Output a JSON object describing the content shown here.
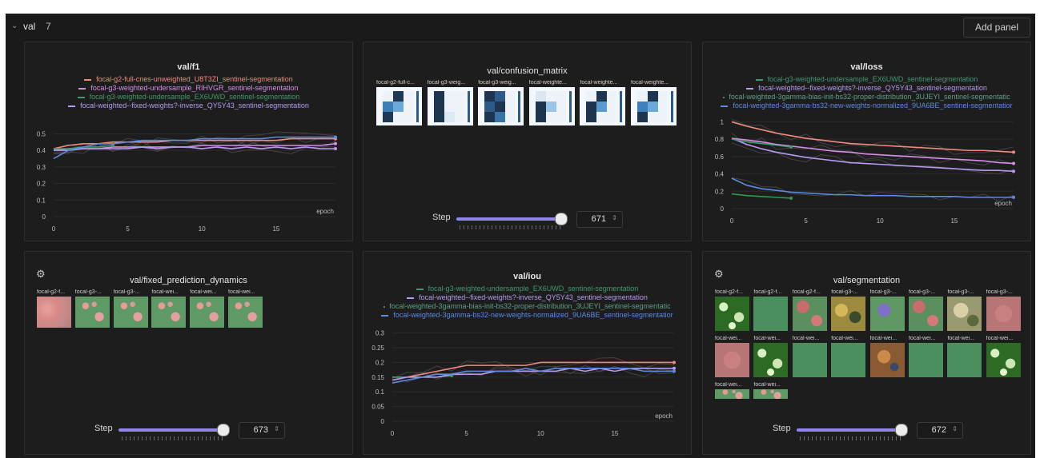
{
  "section": {
    "chevron": "chevron-down-icon",
    "title": "val",
    "count": "7",
    "add_panel": "Add panel"
  },
  "colors": {
    "red": "#f08a7e",
    "pink": "#d88ee8",
    "green": "#3f9a6f",
    "lilac": "#b79af0",
    "blue": "#5b8ae0",
    "accent": "#8f86f0",
    "faint": "#4c4c4c"
  },
  "panels": {
    "f1": {
      "title": "val/f1",
      "legend": [
        {
          "label": "focal-g2-full-cnes-unweighted_U8T3ZI_sentinel-segmentation",
          "color": "#f08a7e"
        },
        {
          "label": "focal-g3-weighted-undersample_RIHVGR_sentinel-segmentation",
          "color": "#d88ee8"
        },
        {
          "label": "focal-g3-weighted-undersample_EX6UWD_sentinel-segmentation",
          "color": "#3f9a6f"
        },
        {
          "label": "focal-weighted--fixed-weights?-inverse_QY5Y43_sentinel-segmentation",
          "color": "#b79af0"
        }
      ],
      "x_label": "epoch",
      "x_ticks": [
        "0",
        "5",
        "10",
        "15"
      ],
      "y_ticks": [
        "0",
        "0.1",
        "0.2",
        "0.3",
        "0.4",
        "0.5"
      ]
    },
    "confusion": {
      "title": "val/confusion_matrix",
      "labels": [
        "focal-g2-full-c...",
        "focal-g3-weig...",
        "focal-g3-weig...",
        "focal-weighte...",
        "focal-weighte...",
        "focal-weighte..."
      ],
      "step_label": "Step",
      "step_value": "671"
    },
    "loss": {
      "title": "val/loss",
      "legend": [
        {
          "label": "focal-g3-weighted-undersample_EX6UWD_sentinel-segmentation",
          "color": "#3f9a6f"
        },
        {
          "label": "focal-weighted--fixed-weights?-inverse_QY5Y43_sentinel-segmentation",
          "color": "#b79af0"
        },
        {
          "label": "focal-weighted-3gamma-bias-init-bs32-proper-distribution_3UJEYI_sentinel-segmentatic",
          "color": "#5fa083",
          "dot": true
        },
        {
          "label": "focal-weighted-3gamma-bs32-new-weights-normalized_9UA6BE_sentinel-segmentatior",
          "color": "#5b8ae0"
        }
      ],
      "x_label": "epoch",
      "x_ticks": [
        "0",
        "5",
        "10",
        "15"
      ],
      "y_ticks": [
        "0",
        "0.2",
        "0.4",
        "0.6",
        "0.8",
        "1"
      ]
    },
    "dynamics": {
      "gear": "gear-icon",
      "title": "val/fixed_prediction_dynamics",
      "labels": [
        "focal-g2-f...",
        "focal-g3-...",
        "focal-g3-...",
        "focal-wei...",
        "focal-wei...",
        "focal-wei..."
      ],
      "step_label": "Step",
      "step_value": "673"
    },
    "iou": {
      "title": "val/iou",
      "legend": [
        {
          "label": "focal-g3-weighted-undersample_EX6UWD_sentinel-segmentation",
          "color": "#3f9a6f"
        },
        {
          "label": "focal-weighted--fixed-weights?-inverse_QY5Y43_sentinel-segmentation",
          "color": "#b79af0"
        },
        {
          "label": "focal-weighted-3gamma-bias-init-bs32-proper-distribution_3UJEYI_sentinel-segmentatic",
          "color": "#5fa083",
          "dot": true
        },
        {
          "label": "focal-weighted-3gamma-bs32-new-weights-normalized_9UA6BE_sentinel-segmentatior",
          "color": "#5b8ae0"
        }
      ],
      "x_label": "epoch",
      "x_ticks": [
        "0",
        "5",
        "10",
        "15"
      ],
      "y_ticks": [
        "0",
        "0.05",
        "0.1",
        "0.15",
        "0.2",
        "0.25",
        "0.3"
      ]
    },
    "segmentation": {
      "gear": "gear-icon",
      "title": "val/segmentation",
      "labels": [
        "focal-g2-f...",
        "focal-g2-f...",
        "focal-g2-f...",
        "focal-g3-...",
        "focal-g3-...",
        "focal-g3-...",
        "focal-g3-...",
        "focal-g3-...",
        "focal-wei...",
        "focal-wei...",
        "focal-wei...",
        "focal-wei...",
        "focal-wei...",
        "focal-wei...",
        "focal-wei...",
        "focal-wei..."
      ],
      "step_label": "Step",
      "step_value": "672"
    }
  },
  "chart_data": [
    {
      "type": "line",
      "title": "val/f1",
      "xlabel": "epoch",
      "xlim": [
        0,
        19
      ],
      "ylim": [
        0,
        0.55
      ],
      "series": [
        {
          "name": "focal-g2-full-cnes-unweighted_U8T3ZI_sentinel-segmentation",
          "color": "#f08a7e",
          "x": [
            0,
            1,
            2,
            3,
            4,
            5,
            6,
            7,
            8,
            9,
            10,
            11,
            12,
            13,
            14,
            15,
            16,
            17,
            18,
            19
          ],
          "y": [
            0.41,
            0.43,
            0.44,
            0.44,
            0.45,
            0.45,
            0.45,
            0.45,
            0.46,
            0.46,
            0.46,
            0.46,
            0.46,
            0.46,
            0.46,
            0.46,
            0.47,
            0.47,
            0.47,
            0.47
          ]
        },
        {
          "name": "focal-g3-weighted-undersample_RIHVGR_sentinel-segmentation",
          "color": "#d88ee8",
          "x": [
            0,
            1,
            2,
            3,
            4,
            5,
            6,
            7,
            8,
            9,
            10,
            11,
            12,
            13,
            14,
            15,
            16,
            17,
            18,
            19
          ],
          "y": [
            0.4,
            0.41,
            0.41,
            0.41,
            0.42,
            0.42,
            0.42,
            0.42,
            0.42,
            0.42,
            0.43,
            0.43,
            0.43,
            0.43,
            0.43,
            0.43,
            0.43,
            0.43,
            0.43,
            0.44
          ]
        },
        {
          "name": "focal-g3-weighted-undersample_EX6UWD_sentinel-segmentation",
          "color": "#3f9a6f",
          "x": [
            0,
            1,
            2,
            3,
            4
          ],
          "y": [
            0.41,
            0.41,
            0.42,
            0.42,
            0.43
          ]
        },
        {
          "name": "focal-weighted--fixed-weights?-inverse_QY5Y43_sentinel-segmentation",
          "color": "#b79af0",
          "x": [
            0,
            1,
            2,
            3,
            4,
            5,
            6,
            7,
            8,
            9,
            10,
            11,
            12,
            13,
            14,
            15,
            16,
            17,
            18,
            19
          ],
          "y": [
            0.4,
            0.4,
            0.41,
            0.41,
            0.41,
            0.41,
            0.42,
            0.41,
            0.42,
            0.42,
            0.41,
            0.42,
            0.41,
            0.42,
            0.41,
            0.42,
            0.41,
            0.42,
            0.41,
            0.41
          ]
        },
        {
          "name": "",
          "color": "#5b8ae0",
          "x": [
            0,
            1,
            2,
            3,
            4,
            5,
            6,
            7,
            8,
            9,
            10,
            11,
            12,
            13,
            14,
            15,
            16,
            17,
            18,
            19
          ],
          "y": [
            0.35,
            0.4,
            0.42,
            0.44,
            0.44,
            0.45,
            0.46,
            0.46,
            0.46,
            0.46,
            0.47,
            0.47,
            0.47,
            0.47,
            0.47,
            0.48,
            0.48,
            0.48,
            0.48,
            0.48
          ]
        }
      ]
    },
    {
      "type": "line",
      "title": "val/loss",
      "xlabel": "epoch",
      "xlim": [
        0,
        19
      ],
      "ylim": [
        0,
        1.05
      ],
      "series": [
        {
          "name": "",
          "color": "#f08a7e",
          "x": [
            0,
            1,
            2,
            3,
            4,
            5,
            6,
            7,
            8,
            9,
            10,
            11,
            12,
            13,
            14,
            15,
            16,
            17,
            18,
            19
          ],
          "y": [
            1.0,
            0.95,
            0.91,
            0.87,
            0.84,
            0.81,
            0.79,
            0.77,
            0.75,
            0.74,
            0.73,
            0.72,
            0.71,
            0.7,
            0.69,
            0.68,
            0.67,
            0.67,
            0.66,
            0.65
          ]
        },
        {
          "name": "focal-weighted--fixed-weights?-inverse_QY5Y43_sentinel-segmentation",
          "color": "#b79af0",
          "x": [
            0,
            1,
            2,
            3,
            4,
            5,
            6,
            7,
            8,
            9,
            10,
            11,
            12,
            13,
            14,
            15,
            16,
            17,
            18,
            19
          ],
          "y": [
            0.81,
            0.74,
            0.69,
            0.65,
            0.62,
            0.59,
            0.57,
            0.55,
            0.53,
            0.52,
            0.51,
            0.5,
            0.49,
            0.48,
            0.47,
            0.46,
            0.45,
            0.44,
            0.44,
            0.43
          ]
        },
        {
          "name": "",
          "color": "#d88ee8",
          "x": [
            0,
            1,
            2,
            3,
            4,
            5,
            6,
            7,
            8,
            9,
            10,
            11,
            12,
            13,
            14,
            15,
            16,
            17,
            18,
            19
          ],
          "y": [
            0.81,
            0.79,
            0.77,
            0.74,
            0.72,
            0.7,
            0.68,
            0.66,
            0.65,
            0.63,
            0.62,
            0.61,
            0.6,
            0.59,
            0.58,
            0.57,
            0.56,
            0.55,
            0.53,
            0.52
          ]
        },
        {
          "name": "focal-g3-weighted-undersample_EX6UWD_sentinel-segmentation",
          "color": "#3f9a6f",
          "x": [
            0,
            1,
            2,
            3,
            4
          ],
          "y": [
            0.8,
            0.77,
            0.75,
            0.73,
            0.71
          ]
        },
        {
          "name": "focal-weighted-3gamma-bias-init-bs32-proper-distribution_3UJEYI_sentinel-segmentatic",
          "color": "#2f9a4a",
          "x": [
            0,
            1,
            2,
            3,
            4
          ],
          "y": [
            0.17,
            0.15,
            0.14,
            0.13,
            0.12
          ]
        },
        {
          "name": "focal-weighted-3gamma-bs32-new-weights-normalized_9UA6BE_sentinel-segmentatior",
          "color": "#5b8ae0",
          "x": [
            0,
            1,
            2,
            3,
            4,
            5,
            6,
            7,
            8,
            9,
            10,
            11,
            12,
            13,
            14,
            15,
            16,
            17,
            18,
            19
          ],
          "y": [
            0.35,
            0.27,
            0.23,
            0.21,
            0.19,
            0.18,
            0.17,
            0.16,
            0.16,
            0.15,
            0.15,
            0.15,
            0.14,
            0.14,
            0.14,
            0.14,
            0.13,
            0.13,
            0.13,
            0.13
          ]
        }
      ]
    },
    {
      "type": "line",
      "title": "val/iou",
      "xlabel": "epoch",
      "xlim": [
        0,
        19
      ],
      "ylim": [
        0,
        0.31
      ],
      "series": [
        {
          "name": "",
          "color": "#f08a7e",
          "x": [
            0,
            1,
            2,
            3,
            4,
            5,
            6,
            7,
            8,
            9,
            10,
            11,
            12,
            13,
            14,
            15,
            16,
            17,
            18,
            19
          ],
          "y": [
            0.15,
            0.15,
            0.16,
            0.17,
            0.18,
            0.19,
            0.19,
            0.19,
            0.19,
            0.19,
            0.2,
            0.2,
            0.2,
            0.2,
            0.2,
            0.2,
            0.2,
            0.2,
            0.2,
            0.2
          ]
        },
        {
          "name": "focal-g3-weighted-undersample_EX6UWD_sentinel-segmentation",
          "color": "#3f9a6f",
          "x": [
            0,
            1,
            2,
            3,
            4
          ],
          "y": [
            0.15,
            0.15,
            0.15,
            0.15,
            0.155
          ]
        },
        {
          "name": "focal-weighted--fixed-weights?-inverse_QY5Y43_sentinel-segmentation",
          "color": "#b79af0",
          "x": [
            0,
            1,
            2,
            3,
            4,
            5,
            6,
            7,
            8,
            9,
            10,
            11,
            12,
            13,
            14,
            15,
            16,
            17,
            18,
            19
          ],
          "y": [
            0.14,
            0.15,
            0.15,
            0.15,
            0.16,
            0.16,
            0.16,
            0.17,
            0.17,
            0.17,
            0.17,
            0.17,
            0.18,
            0.17,
            0.18,
            0.17,
            0.18,
            0.18,
            0.18,
            0.18
          ]
        },
        {
          "name": "focal-weighted-3gamma-bs32-new-weights-normalized_9UA6BE_sentinel-segmentatior",
          "color": "#5b8ae0",
          "x": [
            0,
            1,
            2,
            3,
            4,
            5,
            6,
            7,
            8,
            9,
            10,
            11,
            12,
            13,
            14,
            15,
            16,
            17,
            18,
            19
          ],
          "y": [
            0.13,
            0.14,
            0.15,
            0.16,
            0.16,
            0.17,
            0.17,
            0.17,
            0.17,
            0.18,
            0.17,
            0.18,
            0.18,
            0.18,
            0.18,
            0.18,
            0.18,
            0.17,
            0.17,
            0.17
          ]
        }
      ]
    }
  ]
}
